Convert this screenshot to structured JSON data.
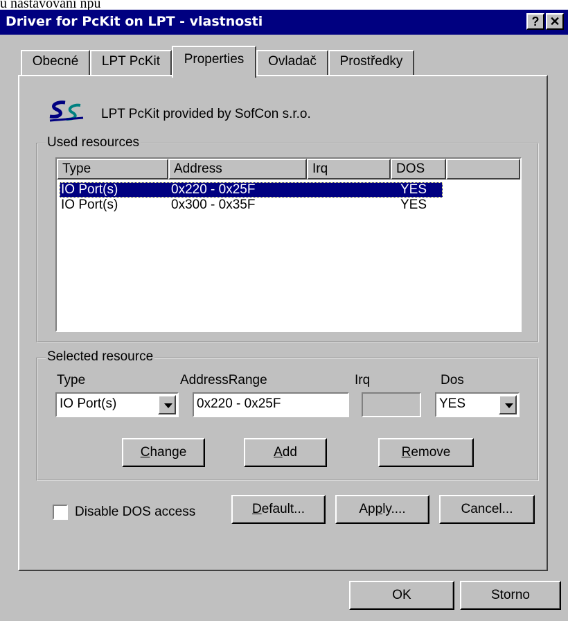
{
  "cut_text": "u nastavování npu",
  "window": {
    "title": "Driver for PcKit on LPT - vlastnosti",
    "help_btn": "?",
    "close_btn": "✕"
  },
  "tabs": [
    {
      "label": "Obecné",
      "active": false
    },
    {
      "label": "LPT PcKit",
      "active": false
    },
    {
      "label": "Properties",
      "active": true
    },
    {
      "label": "Ovladač",
      "active": false
    },
    {
      "label": "Prostředky",
      "active": false
    }
  ],
  "header": {
    "logo_icon": "sofcon-logo-icon",
    "text": "LPT PcKit provided by SofCon s.r.o."
  },
  "used_resources": {
    "group_label": "Used resources",
    "columns": [
      "Type",
      "Address",
      "Irq",
      "DOS"
    ],
    "rows": [
      {
        "type": "IO Port(s)",
        "address": "0x220 - 0x25F",
        "irq": "",
        "dos": "YES",
        "selected": true
      },
      {
        "type": "IO Port(s)",
        "address": "0x300 - 0x35F",
        "irq": "",
        "dos": "YES",
        "selected": false
      }
    ]
  },
  "selected_resource": {
    "group_label": "Selected resource",
    "type_label": "Type",
    "address_label": "AddressRange",
    "irq_label": "Irq",
    "dos_label": "Dos",
    "type_value": "IO Port(s)",
    "address_value": "0x220 - 0x25F",
    "irq_value": "",
    "dos_value": "YES",
    "change_btn": {
      "pre": "",
      "u": "C",
      "post": "hange"
    },
    "add_btn": {
      "pre": "",
      "u": "A",
      "post": "dd"
    },
    "remove_btn": {
      "pre": "",
      "u": "R",
      "post": "emove"
    }
  },
  "options": {
    "disable_dos_label": "Disable DOS access",
    "disable_dos_checked": false,
    "default_btn": {
      "pre": "",
      "u": "D",
      "post": "efault..."
    },
    "apply_btn": {
      "pre": "Ap",
      "u": "p",
      "post": "ly...."
    },
    "cancel_btn": "Cancel..."
  },
  "footer": {
    "ok": "OK",
    "cancel": "Storno"
  }
}
